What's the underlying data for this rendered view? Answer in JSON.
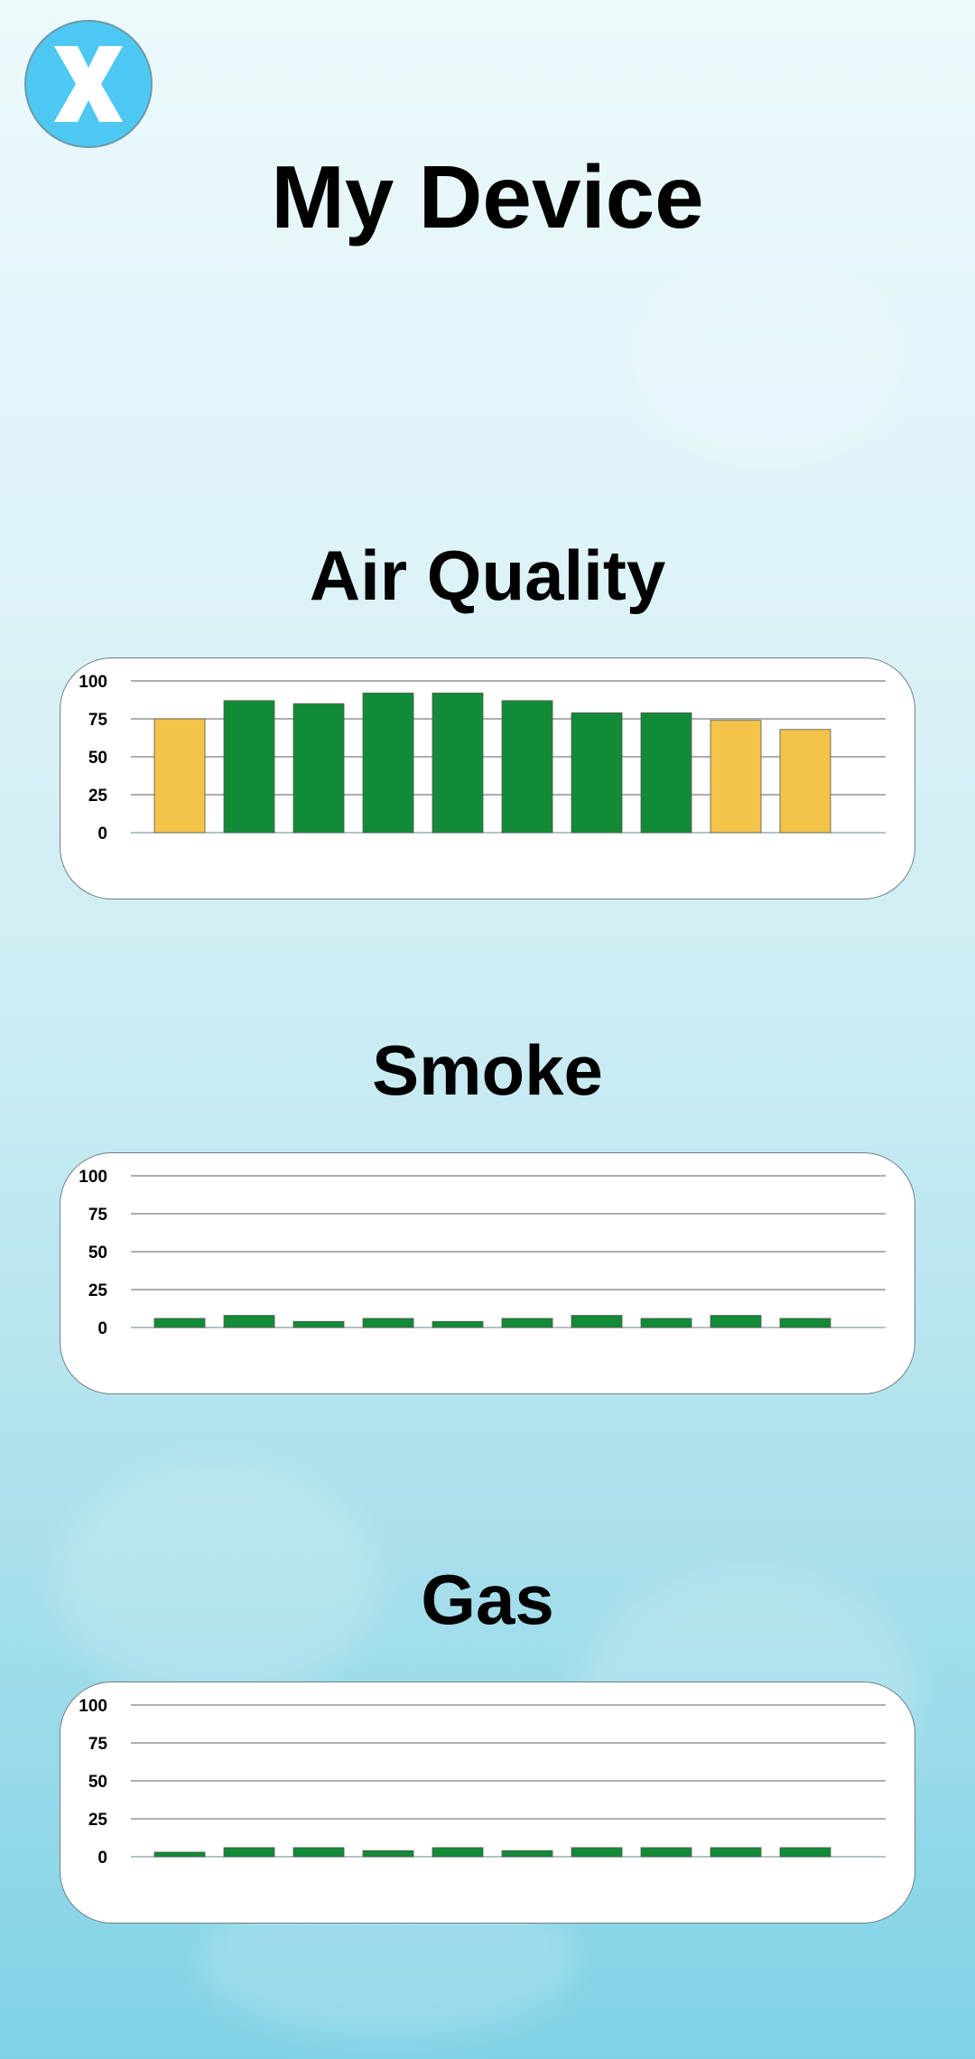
{
  "header": {
    "close_icon": "close-icon",
    "title": "My Device"
  },
  "colors": {
    "good": "#138a38",
    "moderate": "#f4c34a",
    "close_button": "#4ec8f2"
  },
  "sections": [
    {
      "title": "Air Quality",
      "chart_data": {
        "type": "bar",
        "categories": [
          "",
          "",
          "",
          "",
          "",
          "",
          "",
          "",
          "",
          ""
        ],
        "values": [
          75,
          87,
          85,
          92,
          92,
          87,
          79,
          79,
          74,
          68
        ],
        "bar_colors": [
          "#f4c34a",
          "#138a38",
          "#138a38",
          "#138a38",
          "#138a38",
          "#138a38",
          "#138a38",
          "#138a38",
          "#f4c34a",
          "#f4c34a"
        ],
        "yticks": [
          0,
          25,
          50,
          75,
          100
        ],
        "ylim": [
          0,
          100
        ],
        "title": "",
        "xlabel": "",
        "ylabel": "",
        "grid": true,
        "legend": "none"
      }
    },
    {
      "title": "Smoke",
      "chart_data": {
        "type": "bar",
        "categories": [
          "",
          "",
          "",
          "",
          "",
          "",
          "",
          "",
          "",
          ""
        ],
        "values": [
          6,
          8,
          4,
          6,
          4,
          6,
          8,
          6,
          8,
          6
        ],
        "bar_colors": [
          "#138a38",
          "#138a38",
          "#138a38",
          "#138a38",
          "#138a38",
          "#138a38",
          "#138a38",
          "#138a38",
          "#138a38",
          "#138a38"
        ],
        "yticks": [
          0,
          25,
          50,
          75,
          100
        ],
        "ylim": [
          0,
          100
        ],
        "title": "",
        "xlabel": "",
        "ylabel": "",
        "grid": true,
        "legend": "none"
      }
    },
    {
      "title": "Gas",
      "chart_data": {
        "type": "bar",
        "categories": [
          "",
          "",
          "",
          "",
          "",
          "",
          "",
          "",
          "",
          ""
        ],
        "values": [
          3,
          6,
          6,
          4,
          6,
          4,
          6,
          6,
          6,
          6
        ],
        "bar_colors": [
          "#138a38",
          "#138a38",
          "#138a38",
          "#138a38",
          "#138a38",
          "#138a38",
          "#138a38",
          "#138a38",
          "#138a38",
          "#138a38"
        ],
        "yticks": [
          0,
          25,
          50,
          75,
          100
        ],
        "ylim": [
          0,
          100
        ],
        "title": "",
        "xlabel": "",
        "ylabel": "",
        "grid": true,
        "legend": "none"
      }
    }
  ]
}
